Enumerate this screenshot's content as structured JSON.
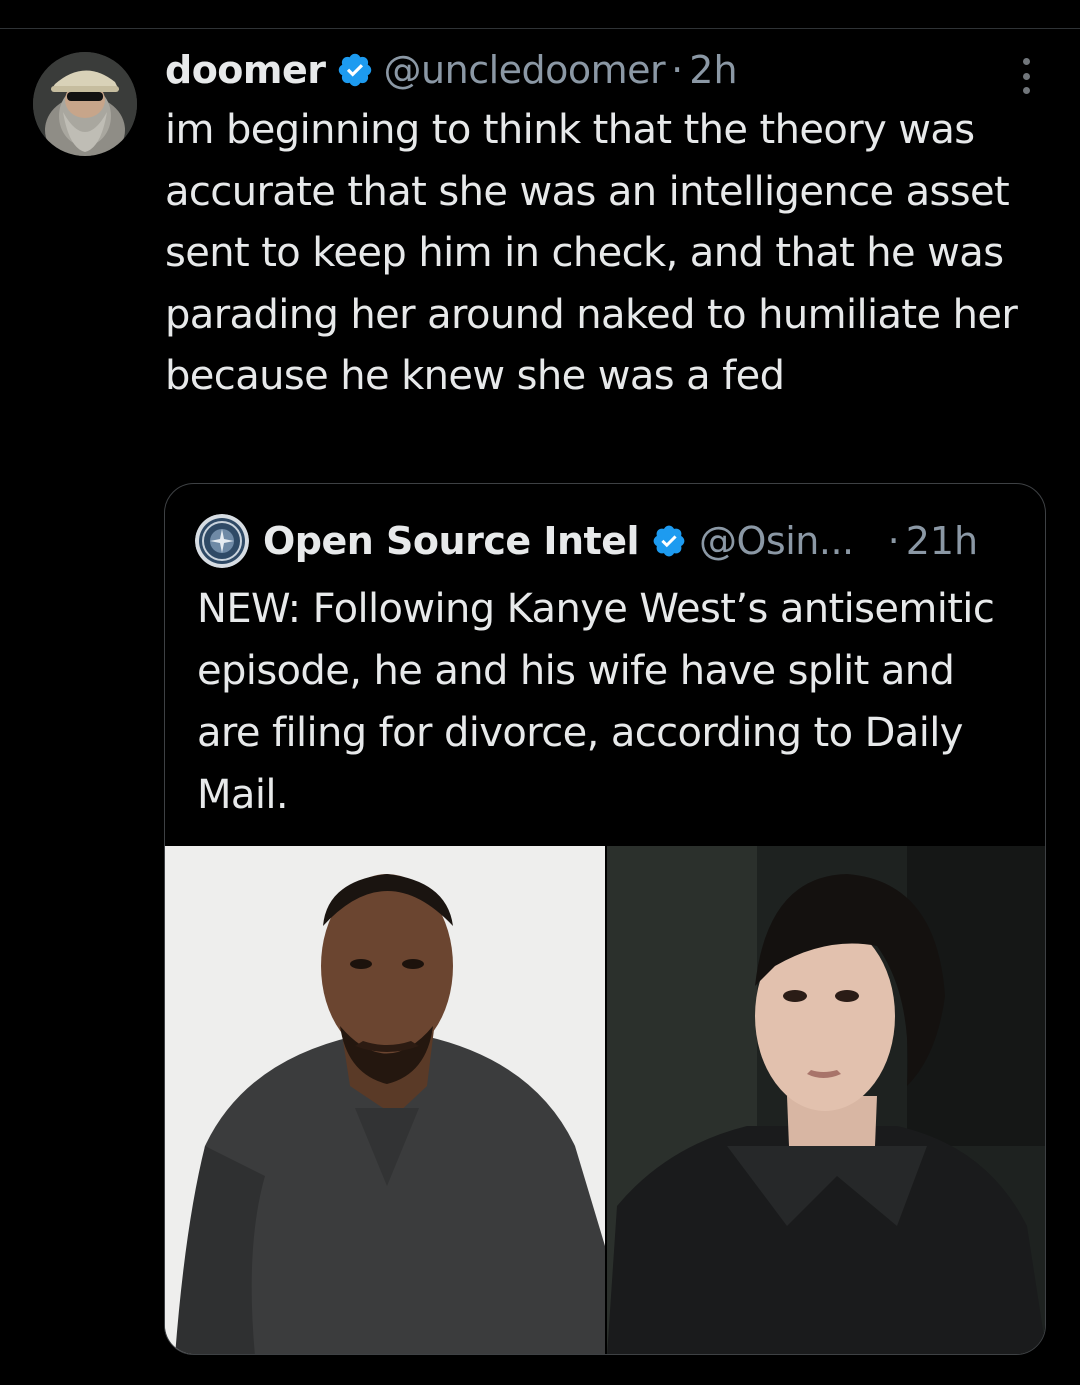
{
  "tweet": {
    "display_name": "doomer",
    "handle": "@uncledoomer",
    "separator": "·",
    "time": "2h",
    "text": "im beginning to think that the theory was accurate that she was an intelligence asset sent to keep him in check, and that he was parading her around naked to humiliate her because he knew she was a fed",
    "verified": true,
    "avatar_icon": "bearded-man-with-cap-avatar",
    "menu_icon": "more-vertical-icon"
  },
  "quote": {
    "display_name": "Open Source Intel",
    "handle": "@Osin...",
    "separator": "·",
    "time": "21h",
    "text": "NEW: Following Kanye West’s antisemitic episode, he and his wife have split and are filing for divorce, according to Daily Mail.",
    "verified": true,
    "avatar_icon": "emblem-seal-avatar",
    "media": [
      {
        "subject": "man-portrait-photo"
      },
      {
        "subject": "woman-portrait-photo"
      }
    ]
  },
  "colors": {
    "background": "#000000",
    "text_primary": "#e7e9ea",
    "text_secondary": "#8b98a5",
    "verified_badge": "#1d9bf0",
    "border": "#3e4144"
  }
}
